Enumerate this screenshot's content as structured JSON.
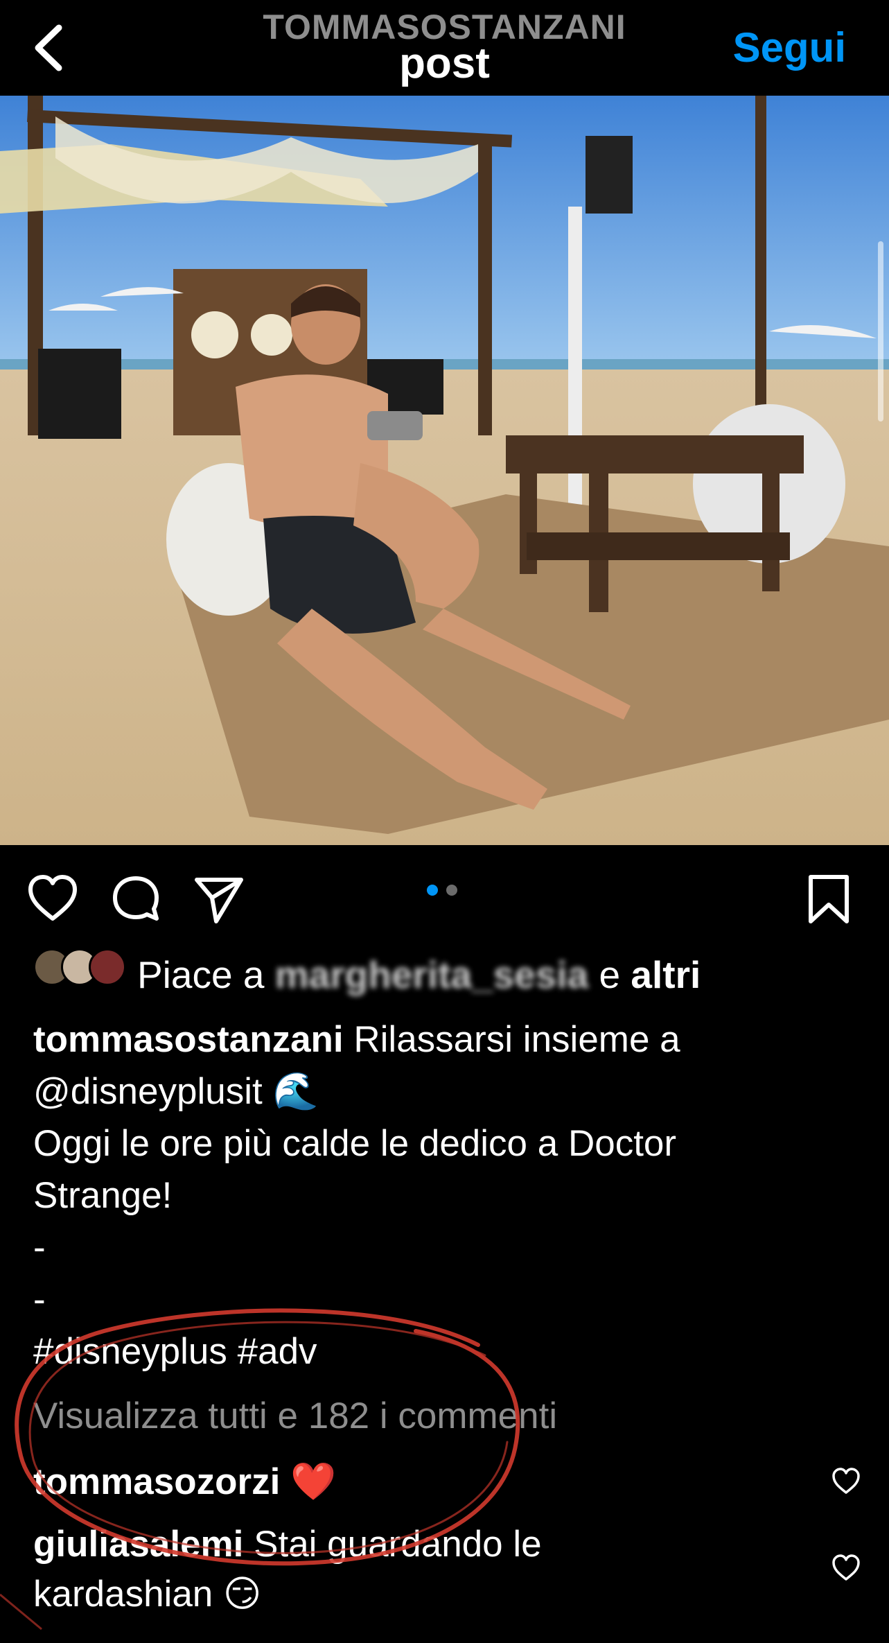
{
  "header": {
    "username": "TOMMASOSTANZANI",
    "title": "post",
    "follow_label": "Segui",
    "back_icon": "chevron-left-icon"
  },
  "photo": {
    "description_icon": "post-photo",
    "carousel_position": {
      "current": 1,
      "total": 2
    }
  },
  "actions": {
    "like_icon": "heart-icon",
    "comment_icon": "comment-bubble-icon",
    "share_icon": "send-icon",
    "save_icon": "bookmark-icon"
  },
  "likes": {
    "prefix": "Piace a ",
    "user": "margherita_sesia",
    "middle": " e ",
    "suffix": "altri"
  },
  "caption": {
    "username": "tommasostanzani",
    "line1": " Rilassarsi insieme a",
    "line2": "@disneyplusit 🌊",
    "line3": "Oggi le ore più calde le dedico a Doctor",
    "line4": "Strange!",
    "line5": "-",
    "line6": "-",
    "line7": "#disneyplus #adv"
  },
  "view_comments": "Visualizza tutti e 182 i commenti",
  "comments": [
    {
      "username": "tommasozorzi",
      "text": " ❤️",
      "like_icon": "heart-outline-icon"
    },
    {
      "username": "giuliasalemi",
      "text": " Stai guardando le",
      "text2": "kardashian 😏",
      "like_icon": "heart-outline-icon"
    }
  ],
  "colors": {
    "accent": "#0095f6",
    "muted": "#8e8e8e",
    "annotation": "#d23a2e"
  }
}
